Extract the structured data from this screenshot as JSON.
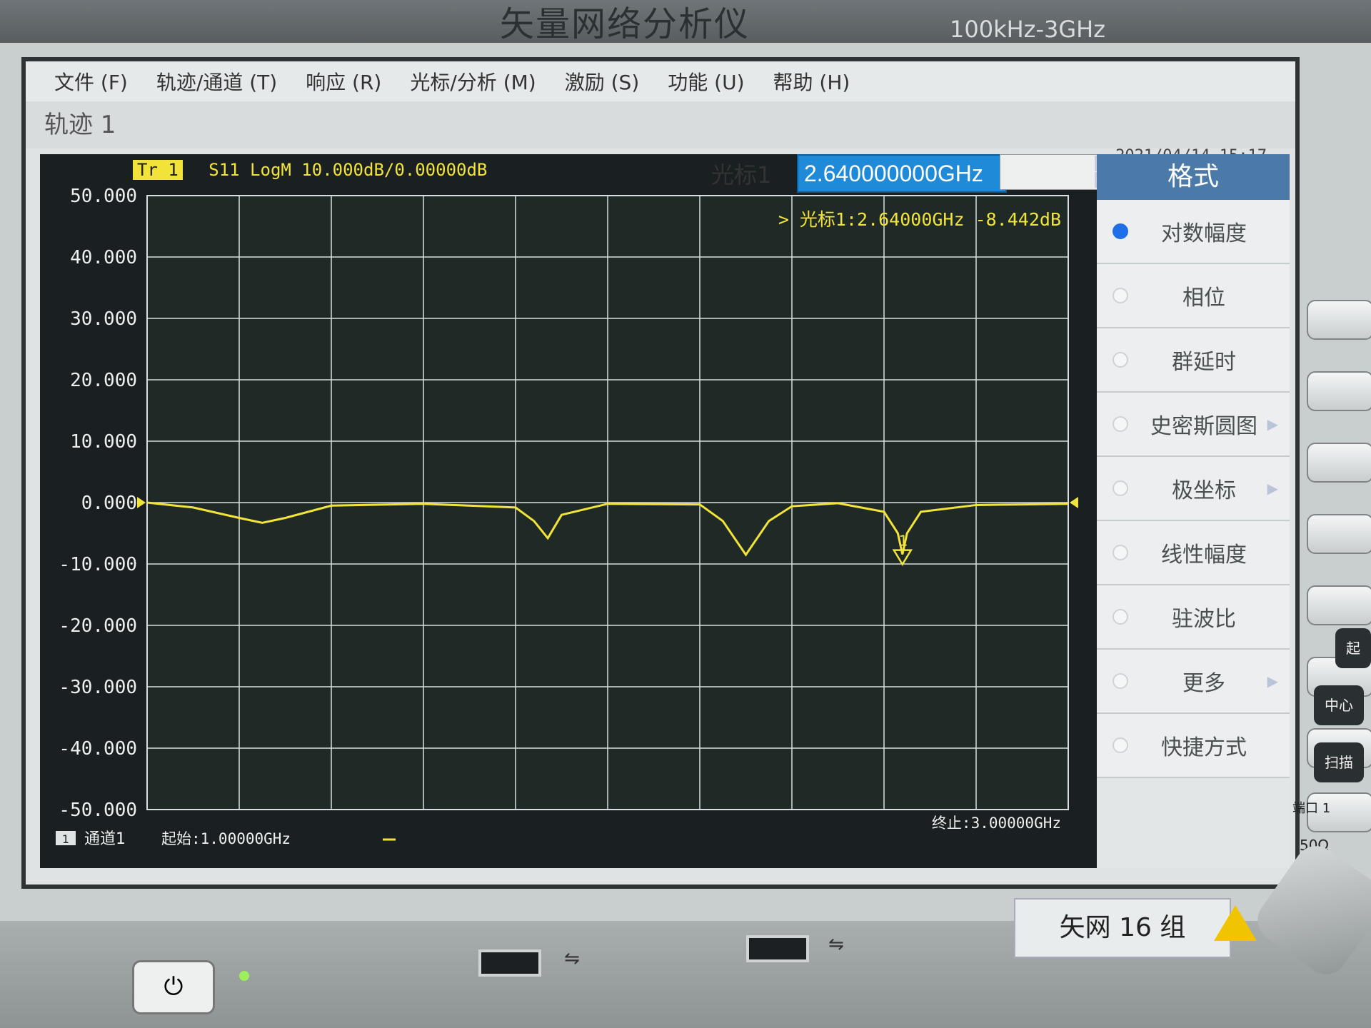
{
  "header": {
    "title": "矢量网络分析仪",
    "range": "100kHz-3GHz"
  },
  "menu": [
    "文件 (F)",
    "轨迹/通道 (T)",
    "响应 (R)",
    "光标/分析 (M)",
    "激励 (S)",
    "功能 (U)",
    "帮助 (H)"
  ],
  "trace_title": "轨迹 1",
  "datetime": "2021/04/14 15:17",
  "trace_header": {
    "badge": "Tr 1",
    "text": "S11 LogM 10.000dB/0.00000dB"
  },
  "marker_box": {
    "label": "光标1",
    "value": "2.640000000GHz"
  },
  "marker_readout": "> 光标1:2.64000GHz -8.442dB",
  "footer": {
    "channel_tag": "1",
    "channel": "通道1",
    "start": "起始:1.00000GHz",
    "stop": "终止:3.00000GHz"
  },
  "softkeys": {
    "title": "格式",
    "items": [
      {
        "label": "对数幅度",
        "selected": true,
        "arrow": false
      },
      {
        "label": "相位",
        "selected": false,
        "arrow": false
      },
      {
        "label": "群延时",
        "selected": false,
        "arrow": false
      },
      {
        "label": "史密斯圆图",
        "selected": false,
        "arrow": true
      },
      {
        "label": "极坐标",
        "selected": false,
        "arrow": true
      },
      {
        "label": "线性幅度",
        "selected": false,
        "arrow": false
      },
      {
        "label": "驻波比",
        "selected": false,
        "arrow": false
      },
      {
        "label": "更多",
        "selected": false,
        "arrow": true
      },
      {
        "label": "快捷方式",
        "selected": false,
        "arrow": false
      }
    ]
  },
  "hardware": {
    "center_btn": "中心",
    "sweep_btn": "扫描",
    "start_btn": "起",
    "port": "端口 1",
    "impedance": "50Ω",
    "plate": "矢网 16 组"
  },
  "colors": {
    "trace": "#f2e33a",
    "grid": "#d9dede",
    "plot_bg": "#1a1f22",
    "accent": "#1e8ad8"
  },
  "chart_data": {
    "type": "line",
    "x_unit": "GHz",
    "y_unit": "dB",
    "xlim": [
      1.0,
      3.0
    ],
    "ylim": [
      -50,
      50
    ],
    "y_ticks": [
      "50.000",
      "40.000",
      "30.000",
      "20.000",
      "10.000",
      "0.000",
      "-10.000",
      "-20.000",
      "-30.000",
      "-40.000",
      "-50.000"
    ],
    "grid": true,
    "series": [
      {
        "x": [
          1.0,
          1.1,
          1.2,
          1.25,
          1.3,
          1.4,
          1.6,
          1.8,
          1.84,
          1.87,
          1.9,
          2.0,
          2.2,
          2.25,
          2.3,
          2.35,
          2.4,
          2.5,
          2.6,
          2.63,
          2.64,
          2.65,
          2.68,
          2.8,
          2.9,
          3.0
        ],
        "y": [
          0,
          -0.8,
          -2.5,
          -3.3,
          -2.5,
          -0.5,
          -0.2,
          -0.8,
          -3,
          -5.8,
          -2,
          -0.2,
          -0.3,
          -3,
          -8.5,
          -3,
          -0.6,
          -0.1,
          -1.5,
          -5,
          -8.442,
          -5,
          -1.5,
          -0.4,
          -0.3,
          -0.2
        ]
      }
    ],
    "markers": [
      {
        "label": "1",
        "x": 2.64,
        "y": -8.442
      }
    ]
  }
}
